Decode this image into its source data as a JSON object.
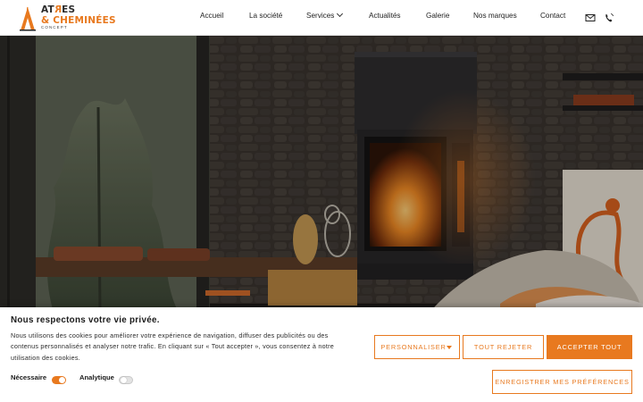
{
  "header": {
    "logo": {
      "line1_a": "AT",
      "line1_b": "R",
      "line1_c": "ES",
      "line2": "& CHEMINÉES",
      "line3": "CONCEPT"
    },
    "nav": {
      "accueil": "Accueil",
      "societe": "La société",
      "services": "Services",
      "actualites": "Actualités",
      "galerie": "Galerie",
      "marques": "Nos marques",
      "contact": "Contact"
    },
    "icons": [
      "mail-icon",
      "phone-icon"
    ]
  },
  "cookie": {
    "title": "Nous respectons votre vie privée.",
    "text": "Nous utilisons des cookies pour améliorer votre expérience de navigation, diffuser des publicités ou des contenus personnalisés et analyser notre trafic. En cliquant sur « Tout accepter », vous consentez à notre utilisation des cookies.",
    "opt_necessaire": "Nécessaire",
    "opt_analytique": "Analytique",
    "toggle_necessaire": true,
    "toggle_analytique": false,
    "btn_personnaliser": "PERSONNALISER",
    "btn_rejeter": "TOUT REJETER",
    "btn_accepter": "ACCEPTER TOUT",
    "btn_enregistrer": "ENREGISTRER MES PRÉFÉRENCES"
  },
  "colors": {
    "accent": "#e8791f",
    "header_bg": "#ffffff",
    "text_dark": "#222222"
  }
}
